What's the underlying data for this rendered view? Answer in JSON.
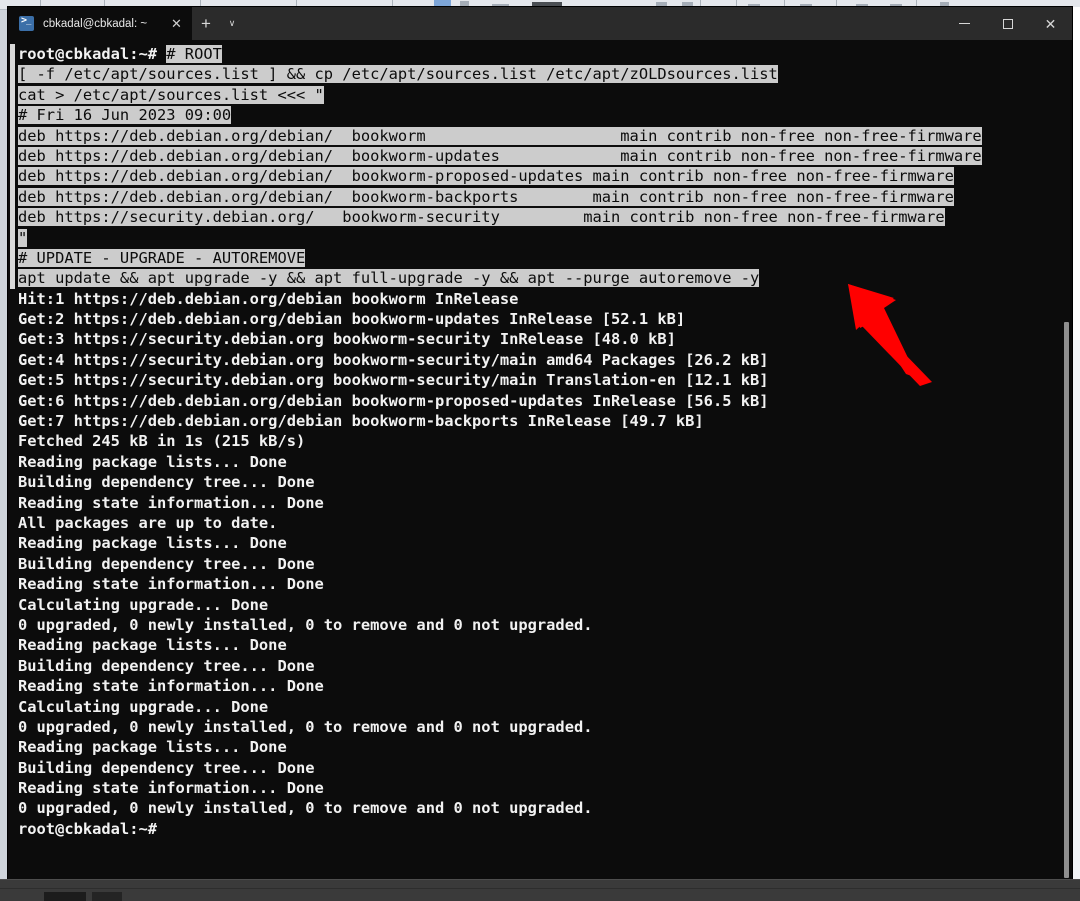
{
  "window": {
    "app_title": "cbkadal@cbkadal: ~",
    "tab_label": "cbkadal@cbkadal: ~",
    "tab_icon": "terminal-icon",
    "close_tab_label": "✕",
    "new_tab_label": "+",
    "dropdown_label": "∨",
    "minimize_label": "–",
    "maximize_label": "❐",
    "close_label": "✕"
  },
  "colors": {
    "terminal_background": "#0c0c0c",
    "terminal_foreground": "#cccccc",
    "selection_background": "#cccccc",
    "selection_foreground": "#0c0c0c",
    "titlebar_background": "#2b2b2b",
    "annotation_arrow": "#ff0000",
    "scrollbar_thumb": "#8f8f8f"
  },
  "annotation": {
    "type": "arrow",
    "color": "#ff0000",
    "points_to": "apt-update-upgrade-command-line",
    "direction": "up-left"
  },
  "terminal": {
    "prompt": "root@cbkadal:~#",
    "lines": [
      {
        "segments": [
          {
            "text": "root@cbkadal:~# ",
            "style": "bold"
          },
          {
            "text": "# ROOT",
            "style": "sel"
          }
        ]
      },
      {
        "segments": [
          {
            "text": "[ -f /etc/apt/sources.list ] && cp /etc/apt/sources.list /etc/apt/zOLDsources.list",
            "style": "sel"
          }
        ]
      },
      {
        "segments": [
          {
            "text": "cat > /etc/apt/sources.list <<< \"",
            "style": "sel"
          }
        ]
      },
      {
        "segments": [
          {
            "text": "# Fri 16 Jun 2023 09:00",
            "style": "sel"
          }
        ]
      },
      {
        "segments": [
          {
            "text": "deb https://deb.debian.org/debian/  bookworm                     main contrib non-free non-free-firmware",
            "style": "sel"
          }
        ]
      },
      {
        "segments": [
          {
            "text": "deb https://deb.debian.org/debian/  bookworm-updates             main contrib non-free non-free-firmware",
            "style": "sel"
          }
        ]
      },
      {
        "segments": [
          {
            "text": "deb https://deb.debian.org/debian/  bookworm-proposed-updates main contrib non-free non-free-firmware",
            "style": "sel"
          }
        ]
      },
      {
        "segments": [
          {
            "text": "deb https://deb.debian.org/debian/  bookworm-backports        main contrib non-free non-free-firmware",
            "style": "sel"
          }
        ]
      },
      {
        "segments": [
          {
            "text": "deb https://security.debian.org/   bookworm-security         main contrib non-free non-free-firmware",
            "style": "sel"
          }
        ]
      },
      {
        "segments": [
          {
            "text": "\"",
            "style": "sel"
          }
        ]
      },
      {
        "segments": [
          {
            "text": "# UPDATE - UPGRADE - AUTOREMOVE",
            "style": "sel"
          }
        ]
      },
      {
        "segments": [
          {
            "text": "apt update && apt upgrade -y && apt full-upgrade -y && apt --purge autoremove -y",
            "style": "sel"
          }
        ]
      },
      {
        "segments": [
          {
            "text": "Hit:1 https://deb.debian.org/debian bookworm InRelease",
            "style": "bold"
          }
        ]
      },
      {
        "segments": [
          {
            "text": "Get:2 https://deb.debian.org/debian bookworm-updates InRelease [52.1 kB]",
            "style": "bold"
          }
        ]
      },
      {
        "segments": [
          {
            "text": "Get:3 https://security.debian.org bookworm-security InRelease [48.0 kB]",
            "style": "bold"
          }
        ]
      },
      {
        "segments": [
          {
            "text": "Get:4 https://security.debian.org bookworm-security/main amd64 Packages [26.2 kB]",
            "style": "bold"
          }
        ]
      },
      {
        "segments": [
          {
            "text": "Get:5 https://security.debian.org bookworm-security/main Translation-en [12.1 kB]",
            "style": "bold"
          }
        ]
      },
      {
        "segments": [
          {
            "text": "Get:6 https://deb.debian.org/debian bookworm-proposed-updates InRelease [56.5 kB]",
            "style": "bold"
          }
        ]
      },
      {
        "segments": [
          {
            "text": "Get:7 https://deb.debian.org/debian bookworm-backports InRelease [49.7 kB]",
            "style": "bold"
          }
        ]
      },
      {
        "segments": [
          {
            "text": "Fetched 245 kB in 1s (215 kB/s)",
            "style": "bold"
          }
        ]
      },
      {
        "segments": [
          {
            "text": "Reading package lists... Done",
            "style": "bold"
          }
        ]
      },
      {
        "segments": [
          {
            "text": "Building dependency tree... Done",
            "style": "bold"
          }
        ]
      },
      {
        "segments": [
          {
            "text": "Reading state information... Done",
            "style": "bold"
          }
        ]
      },
      {
        "segments": [
          {
            "text": "All packages are up to date.",
            "style": "bold"
          }
        ]
      },
      {
        "segments": [
          {
            "text": "Reading package lists... Done",
            "style": "bold"
          }
        ]
      },
      {
        "segments": [
          {
            "text": "Building dependency tree... Done",
            "style": "bold"
          }
        ]
      },
      {
        "segments": [
          {
            "text": "Reading state information... Done",
            "style": "bold"
          }
        ]
      },
      {
        "segments": [
          {
            "text": "Calculating upgrade... Done",
            "style": "bold"
          }
        ]
      },
      {
        "segments": [
          {
            "text": "0 upgraded, 0 newly installed, 0 to remove and 0 not upgraded.",
            "style": "bold"
          }
        ]
      },
      {
        "segments": [
          {
            "text": "Reading package lists... Done",
            "style": "bold"
          }
        ]
      },
      {
        "segments": [
          {
            "text": "Building dependency tree... Done",
            "style": "bold"
          }
        ]
      },
      {
        "segments": [
          {
            "text": "Reading state information... Done",
            "style": "bold"
          }
        ]
      },
      {
        "segments": [
          {
            "text": "Calculating upgrade... Done",
            "style": "bold"
          }
        ]
      },
      {
        "segments": [
          {
            "text": "0 upgraded, 0 newly installed, 0 to remove and 0 not upgraded.",
            "style": "bold"
          }
        ]
      },
      {
        "segments": [
          {
            "text": "Reading package lists... Done",
            "style": "bold"
          }
        ]
      },
      {
        "segments": [
          {
            "text": "Building dependency tree... Done",
            "style": "bold"
          }
        ]
      },
      {
        "segments": [
          {
            "text": "Reading state information... Done",
            "style": "bold"
          }
        ]
      },
      {
        "segments": [
          {
            "text": "0 upgraded, 0 newly installed, 0 to remove and 0 not upgraded.",
            "style": "bold"
          }
        ]
      },
      {
        "segments": [
          {
            "text": "root@cbkadal:~#",
            "style": "bold"
          }
        ]
      }
    ]
  }
}
